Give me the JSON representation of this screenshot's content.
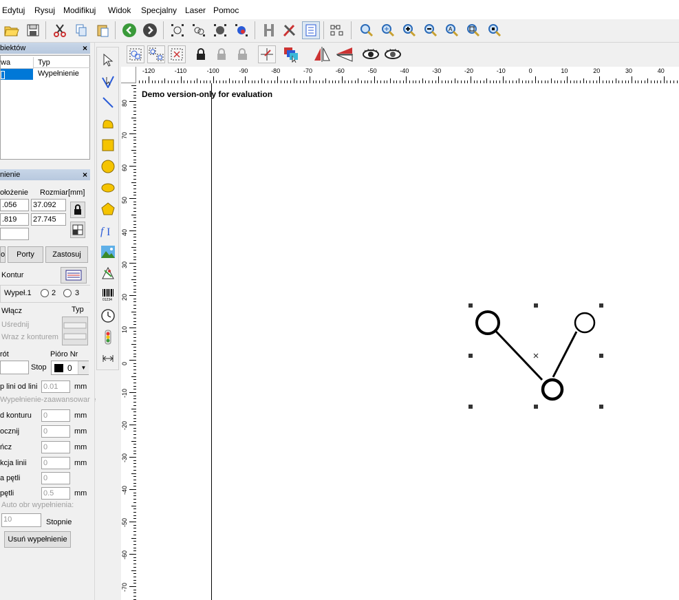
{
  "menu": [
    "Edytuj",
    "Rysuj",
    "Modifikuj",
    "Widok",
    "Specjalny",
    "Laser",
    "Pomoc"
  ],
  "objects_panel": {
    "title": "biektów",
    "col_name": "wa",
    "col_type": "Typ",
    "row_type": "Wypełnienie"
  },
  "fill_panel": {
    "title": "nienie",
    "position_label": "ołożenie",
    "size_label": "Rozmiar[mm]",
    "x_pos": ".056",
    "y_pos": ".819",
    "width": "37.092",
    "height": "27.745",
    "btn_left": "o",
    "btn_ports": "Porty",
    "btn_apply": "Zastosuj",
    "contour_label": "Kontur",
    "fill1_label": "Wypeł.1",
    "radio2": "2",
    "radio3": "3",
    "enable_label": "Włącz",
    "type_label": "Typ",
    "middle_label": "Uśrednij",
    "with_contour_label": "Wraz z konturem",
    "rot_label": "rót",
    "stop_label": "Stop",
    "pen_label": "Pióro Nr",
    "pen_value": "0",
    "line_spacing_label": "p lini od lini",
    "line_spacing_value": "0.01",
    "mm1": "mm",
    "advanced_label": "Wypełnienie-zaawansowane",
    "contour_dist_label": "d konturu",
    "contour_dist_value": "0",
    "mm2": "mm",
    "start_label": "ocznij",
    "start_value": "0",
    "mm3": "mm",
    "end_label": "ńcz",
    "end_value": "0",
    "mm4": "mm",
    "reduce_label": "kcja linii",
    "reduce_value": "0",
    "mm5": "mm",
    "loop_label": "a pętli",
    "loop_value": "0",
    "loop2_label": "pętli",
    "loop2_value": "0.5",
    "mm6": "mm",
    "auto_rot_label": "Auto obr wypełnienia:",
    "degree_value": "10",
    "degree_label": "Stopnie",
    "remove_fill_btn": "Usuń wypełnienie"
  },
  "canvas": {
    "demo_text": "Demo version-only for evaluation"
  },
  "ruler": {
    "h_labels": [
      "-120",
      "-110",
      "-100",
      "-90",
      "-80",
      "-70",
      "-60",
      "-50",
      "-40",
      "-30",
      "-20",
      "-10",
      "0",
      "10",
      "20",
      "30",
      "40"
    ],
    "v_labels": [
      "80",
      "70",
      "60",
      "50",
      "40",
      "30",
      "20",
      "10",
      "0",
      "-10",
      "-20",
      "-30",
      "-40",
      "-50",
      "-60",
      "-70"
    ]
  },
  "colors": {
    "accent": "#0078d7",
    "selection_row": "#0078d7",
    "panel_head": "#c3d2e6"
  }
}
